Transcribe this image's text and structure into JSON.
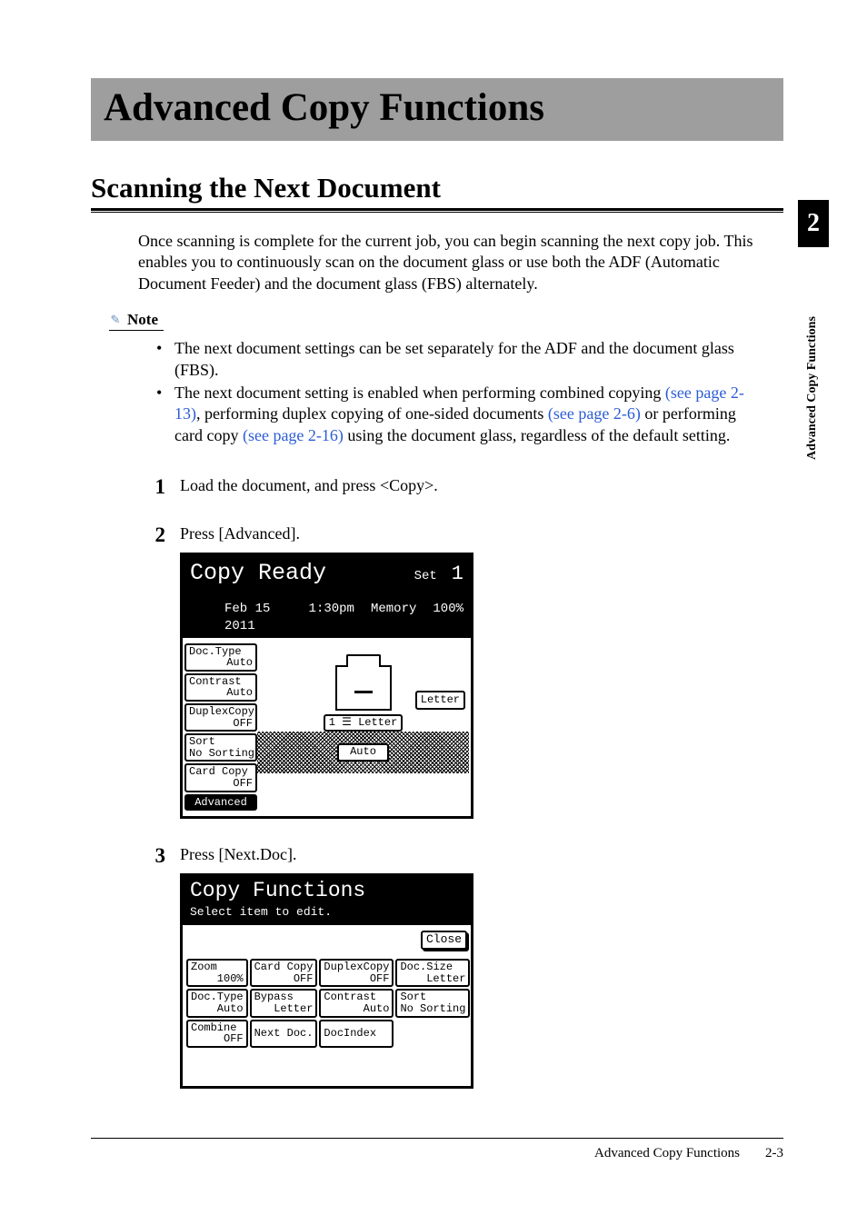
{
  "chapter": {
    "title": "Advanced Copy Functions",
    "section_heading": "Scanning the Next Document",
    "number": "2",
    "side_label": "Advanced Copy Functions"
  },
  "intro": "Once scanning is complete for the current job, you can begin scanning the next copy job. This enables you to continuously scan on the document glass or use both the ADF (Automatic Document Feeder) and the document glass (FBS) alternately.",
  "note": {
    "label": "Note",
    "bullets": [
      {
        "pre": "The next document settings can be set separately for the ADF and the document glass (FBS).",
        "links": []
      },
      {
        "pre": "The next document setting is enabled when performing combined copying ",
        "link1": "(see page 2-13)",
        "mid1": ", performing duplex copying of one-sided documents ",
        "link2": "(see page 2-6)",
        "mid2": " or performing card copy ",
        "link3": "(see page 2-16)",
        "post": " using the document glass, regardless of the default setting."
      }
    ]
  },
  "steps": {
    "s1": {
      "num": "1",
      "text": "Load the document, and press <Copy>."
    },
    "s2": {
      "num": "2",
      "text": "Press [Advanced]."
    },
    "s3": {
      "num": "3",
      "text": "Press [Next.Doc]."
    }
  },
  "lcd1": {
    "ready": "Copy Ready",
    "set_label": "Set",
    "set_value": "1",
    "date": "Feb 15 2011",
    "time": "1:30pm",
    "mem_label": "Memory",
    "mem_value": "100%",
    "side": [
      {
        "label": "Doc.Type",
        "value": "Auto"
      },
      {
        "label": "Contrast",
        "value": "Auto"
      },
      {
        "label": "DuplexCopy",
        "value": "OFF"
      },
      {
        "label": "Sort",
        "value": "No Sorting"
      },
      {
        "label": "Card Copy",
        "value": "OFF"
      }
    ],
    "advanced": "Advanced",
    "paper": "Letter",
    "tray": "1 ☰ Letter",
    "auto": "Auto"
  },
  "lcd2": {
    "title": "Copy Functions",
    "subtitle": "Select item to edit.",
    "close": "Close",
    "grid": [
      {
        "label": "Zoom",
        "value": "100%"
      },
      {
        "label": "Card Copy",
        "value": "OFF"
      },
      {
        "label": "DuplexCopy",
        "value": "OFF"
      },
      {
        "label": "Doc.Size",
        "value": "Letter"
      },
      {
        "label": "Doc.Type",
        "value": "Auto"
      },
      {
        "label": "Bypass",
        "value": "Letter"
      },
      {
        "label": "Contrast",
        "value": "Auto"
      },
      {
        "label": "Sort",
        "value": "No Sorting"
      },
      {
        "label": "Combine",
        "value": "OFF"
      },
      {
        "label": "Next Doc.",
        "value": ""
      },
      {
        "label": "DocIndex",
        "value": ""
      }
    ]
  },
  "footer": {
    "title": "Advanced Copy Functions",
    "page": "2-3"
  }
}
